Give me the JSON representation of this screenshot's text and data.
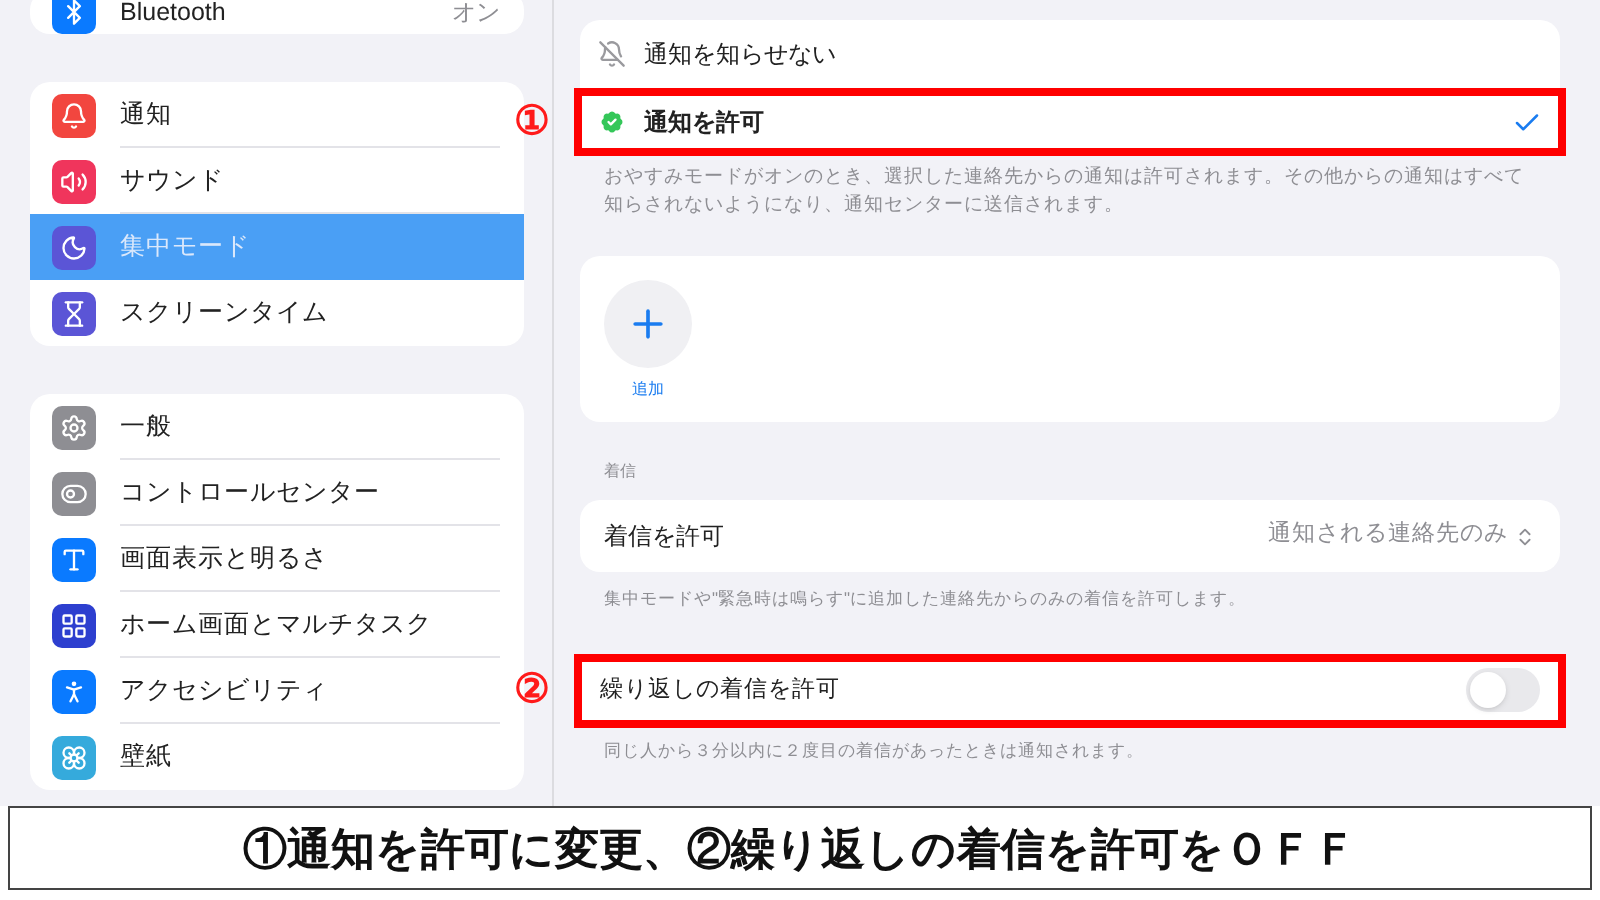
{
  "sidebar": {
    "groups": [
      {
        "items": [
          {
            "label": "Bluetooth",
            "value": "オン",
            "kind": "bluetooth",
            "selected": false
          }
        ]
      },
      {
        "items": [
          {
            "label": "通知",
            "kind": "bell",
            "selected": false
          },
          {
            "label": "サウンド",
            "kind": "sound",
            "selected": false
          },
          {
            "label": "集中モード",
            "kind": "moon",
            "selected": true
          },
          {
            "label": "スクリーンタイム",
            "kind": "hourglass",
            "selected": false
          }
        ]
      },
      {
        "items": [
          {
            "label": "一般",
            "kind": "gear",
            "selected": false
          },
          {
            "label": "コントロールセンター",
            "kind": "toggles",
            "selected": false
          },
          {
            "label": "画面表示と明るさ",
            "kind": "text",
            "selected": false
          },
          {
            "label": "ホーム画面とマルチタスク",
            "kind": "grid",
            "selected": false
          },
          {
            "label": "アクセシビリティ",
            "kind": "person",
            "selected": false
          },
          {
            "label": "壁紙",
            "kind": "flower",
            "selected": false
          }
        ]
      }
    ]
  },
  "notification_options": [
    {
      "label": "通知を知らせない",
      "kind": "bell-off",
      "selected": false,
      "highlighted": false
    },
    {
      "label": "通知を許可",
      "kind": "badge",
      "selected": true,
      "highlighted": true,
      "marker": "①"
    }
  ],
  "notification_hint": "おやすみモードがオンのとき、選択した連絡先からの通知は許可されます。その他からの通知はすべて知らされないようになり、通知センターに送信されます。",
  "add_button": {
    "label": "追加"
  },
  "calls": {
    "section_label": "着信",
    "allow_calls": {
      "label": "着信を許可",
      "value": "通知される連絡先のみ"
    },
    "allow_hint": "集中モードや\"緊急時は鳴らす\"に追加した連絡先からのみの着信を許可します。",
    "repeated_calls": {
      "label": "繰り返しの着信を許可",
      "on": false,
      "highlighted": true,
      "marker": "②"
    },
    "repeated_hint": "同じ人から３分以内に２度目の着信があったときは通知されます。"
  },
  "caption": "①通知を許可に変更、②繰り返しの着信を許可をＯＦＦ"
}
